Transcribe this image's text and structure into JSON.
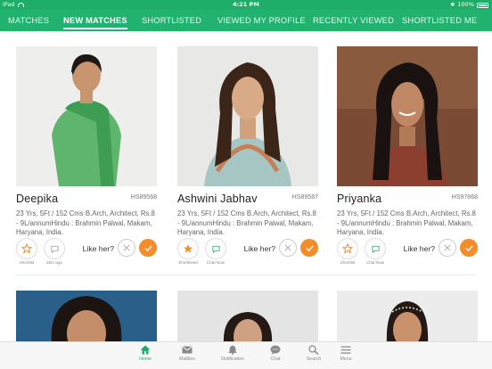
{
  "status_bar": {
    "device": "iPad",
    "time": "4:21 PM",
    "battery": "100%"
  },
  "tabs": [
    {
      "label": "MATCHES",
      "active": false
    },
    {
      "label": "NEW MATCHES",
      "active": true
    },
    {
      "label": "SHORTLISTED",
      "active": false
    },
    {
      "label": "VIEWED MY PROFILE",
      "active": false
    },
    {
      "label": "RECENTLY VIEWED",
      "active": false
    },
    {
      "label": "SHORTLISTED ME",
      "active": false
    }
  ],
  "profiles": [
    {
      "name": "Deepika",
      "id": "HS89568",
      "details": "23 Yrs, 5Ft / 152 Cms B.Arch, Architect, Rs.8 - 9L/annumHindu : Brahmin Palwal, Makam, Haryana, India.",
      "shortlist_label": "Shortlist",
      "chat_label": "30m ago",
      "shortlisted": false,
      "like_prompt": "Like her?"
    },
    {
      "name": "Ashwini Jabhav",
      "id": "HS89587",
      "details": "23 Yrs, 5Ft / 152 Cms B.Arch, Architect, Rs.8 - 9L/annumHindu : Brahmin Palwal, Makam, Haryana, India.",
      "shortlist_label": "Shortlisted",
      "chat_label": "Chat Now",
      "shortlisted": true,
      "like_prompt": "Like her?"
    },
    {
      "name": "Priyanka",
      "id": "HS97868",
      "details": "23 Yrs, 5Ft / 152 Cms B.Arch, Architect, Rs.8 - 9L/annumHindu : Brahmin Palwal, Makam, Haryana, India.",
      "shortlist_label": "Shortlist",
      "chat_label": "Chat Now",
      "shortlisted": false,
      "like_prompt": "Like her?"
    }
  ],
  "bottom_nav": [
    {
      "label": "Home",
      "icon": "home-icon",
      "active": true
    },
    {
      "label": "Mailbox",
      "icon": "mail-icon",
      "active": false
    },
    {
      "label": "Notification",
      "icon": "bell-icon",
      "active": false
    },
    {
      "label": "Chat",
      "icon": "chat-icon",
      "active": false
    },
    {
      "label": "Search",
      "icon": "search-icon",
      "active": false
    },
    {
      "label": "Menu",
      "icon": "menu-icon",
      "active": false
    }
  ],
  "colors": {
    "brand_green": "#22b26f",
    "accent_orange": "#f48c2a"
  }
}
